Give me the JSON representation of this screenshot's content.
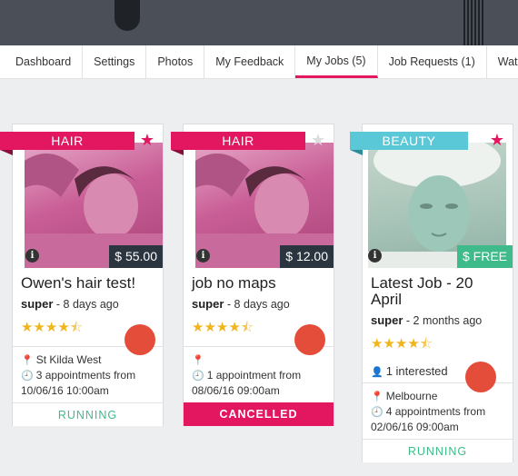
{
  "nav": {
    "tabs": [
      {
        "label": "Dashboard"
      },
      {
        "label": "Settings"
      },
      {
        "label": "Photos"
      },
      {
        "label": "My Feedback"
      },
      {
        "label": "My Jobs (5)"
      },
      {
        "label": "Job Requests (1)"
      },
      {
        "label": "Watchlist"
      }
    ],
    "active_tab": "My Jobs (5)"
  },
  "colors": {
    "accent": "#e3175f",
    "beauty": "#5bc8d8",
    "running": "#3fba8a",
    "star": "#f1b51c",
    "dot": "#e44d3a"
  },
  "cards": [
    {
      "category": "HAIR",
      "price": "$ 55.00",
      "title": "Owen's hair test!",
      "user": "super",
      "posted": " - 8 days ago",
      "rating": 4.5,
      "location": "St Kilda West",
      "appointments": "3 appointments from 10/06/16 10:00am",
      "status": "RUNNING",
      "favorited": true
    },
    {
      "category": "HAIR",
      "price": "$ 12.00",
      "title": "job no maps",
      "user": "super",
      "posted": " - 8 days ago",
      "rating": 4.5,
      "location": "",
      "appointments": "1 appointment from 08/06/16 09:00am",
      "status": "CANCELLED",
      "favorited": false
    },
    {
      "category": "BEAUTY",
      "price": "$ FREE",
      "title": "Latest Job - 20 April",
      "user": "super",
      "posted": " - 2 months ago",
      "rating": 4.5,
      "interested": "1 interested",
      "location": "Melbourne",
      "appointments": "4 appointments from 02/06/16 09:00am",
      "status": "RUNNING",
      "favorited": true
    }
  ],
  "icons": {
    "info": "info-icon",
    "star": "star-icon",
    "pin": "map-pin-icon",
    "clock": "clock-icon",
    "user": "user-icon"
  }
}
